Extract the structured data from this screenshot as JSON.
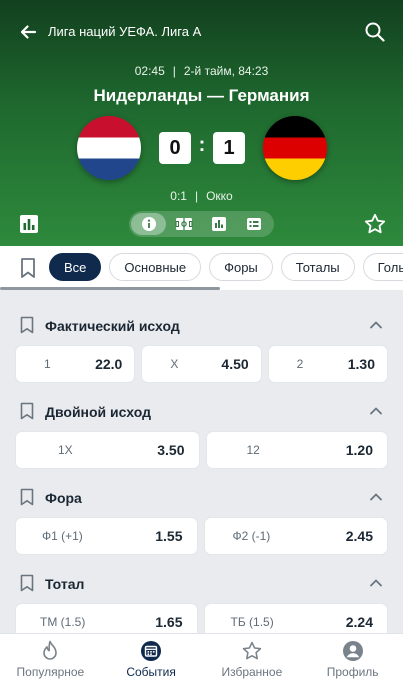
{
  "header": {
    "league_title": "Лига наций УЕФА. Лига A",
    "time": "02:45",
    "period": "2-й тайм, 84:23",
    "teams_title": "Нидерланды — Германия",
    "home_score": "0",
    "away_score": "1",
    "score_separator": ":",
    "first_half_score": "0:1",
    "broadcaster": "Окко",
    "divider": "|"
  },
  "colors": {
    "header_dark": "#12401f",
    "header_light": "#2e8a3c",
    "chip_active": "#0f2a4c"
  },
  "view_switch": [
    "info-icon",
    "field-icon",
    "stats-icon",
    "lineup-icon"
  ],
  "filter_chips": [
    "Все",
    "Основные",
    "Форы",
    "Тоталы",
    "Голы"
  ],
  "markets": [
    {
      "title": "Фактический исход",
      "odds": [
        {
          "label": "1",
          "value": "22.0"
        },
        {
          "label": "X",
          "value": "4.50"
        },
        {
          "label": "2",
          "value": "1.30"
        }
      ]
    },
    {
      "title": "Двойной исход",
      "odds": [
        {
          "label": "1X",
          "value": "3.50"
        },
        {
          "label": "12",
          "value": "1.20"
        }
      ]
    },
    {
      "title": "Фора",
      "odds": [
        {
          "label": "Ф1 (+1)",
          "value": "1.55"
        },
        {
          "label": "Ф2 (-1)",
          "value": "2.45"
        }
      ]
    },
    {
      "title": "Тотал",
      "odds": [
        {
          "label": "ТМ (1.5)",
          "value": "1.65"
        },
        {
          "label": "ТБ (1.5)",
          "value": "2.24"
        }
      ]
    }
  ],
  "bottom_nav": [
    {
      "label": "Популярное",
      "icon": "flame-icon"
    },
    {
      "label": "События",
      "icon": "calendar-icon",
      "active": true
    },
    {
      "label": "Избранное",
      "icon": "star-icon"
    },
    {
      "label": "Профиль",
      "icon": "user-icon"
    }
  ]
}
